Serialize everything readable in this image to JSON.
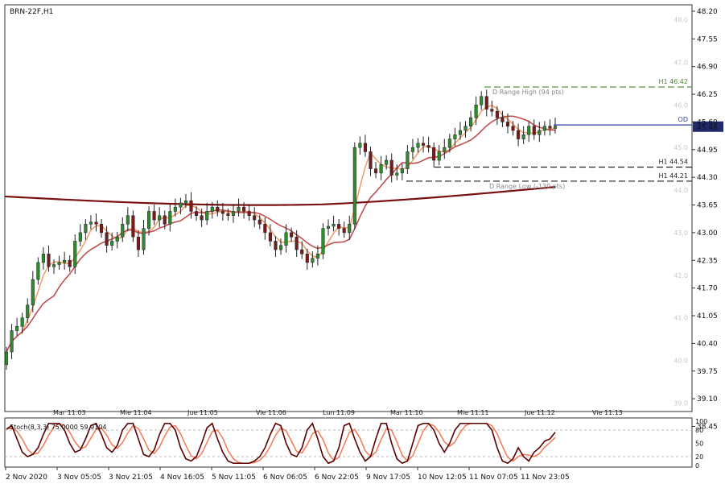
{
  "chart_data": {
    "type": "candlestick",
    "symbol_label": "BRN-22F,H1",
    "price_axis": {
      "ylim": [
        38.8,
        48.35
      ],
      "ticks": [
        "48.20",
        "47.55",
        "46.90",
        "46.25",
        "45.60",
        "44.95",
        "44.30",
        "43.65",
        "43.00",
        "42.35",
        "41.70",
        "41.05",
        "40.40",
        "39.75",
        "39.10",
        "38.45"
      ]
    },
    "background_levels": [
      "48.0",
      "47.0",
      "46.0",
      "45.0",
      "44.0",
      "43.0",
      "42.0",
      "41.0",
      "40.0",
      "39.0"
    ],
    "session_labels": [
      "Mar 11.03",
      "Mie 11.04",
      "Jue 11.05",
      "Vie 11.06",
      "Lun 11.09",
      "Mar 11.10",
      "Mie 11.11",
      "Jue 11.12",
      "Vie 11.13"
    ],
    "time_labels": [
      "2 Nov 2020",
      "3 Nov 05:05",
      "3 Nov 21:05",
      "4 Nov 16:05",
      "5 Nov 11:05",
      "6 Nov 06:05",
      "6 Nov 22:05",
      "9 Nov 17:05",
      "10 Nov 12:05",
      "11 Nov 07:05",
      "11 Nov 23:05"
    ],
    "closes": [
      40.2,
      40.7,
      40.8,
      41.0,
      41.3,
      41.9,
      42.3,
      42.5,
      42.2,
      42.25,
      42.3,
      42.35,
      42.2,
      42.8,
      43.0,
      43.2,
      43.25,
      43.2,
      43.0,
      42.7,
      42.8,
      42.9,
      43.2,
      43.4,
      42.9,
      42.6,
      43.1,
      43.5,
      43.3,
      43.4,
      43.2,
      43.5,
      43.6,
      43.7,
      43.75,
      43.5,
      43.4,
      43.3,
      43.5,
      43.6,
      43.5,
      43.45,
      43.4,
      43.5,
      43.6,
      43.5,
      43.4,
      43.3,
      43.2,
      43.0,
      42.8,
      42.6,
      42.7,
      43.0,
      42.9,
      42.6,
      42.5,
      42.3,
      42.4,
      42.5,
      43.1,
      43.15,
      43.2,
      43.1,
      43.0,
      43.2,
      45.0,
      45.1,
      44.9,
      44.5,
      44.4,
      44.6,
      44.7,
      44.35,
      44.4,
      44.5,
      44.9,
      45.0,
      45.1,
      45.05,
      45.0,
      44.7,
      44.9,
      45.0,
      45.2,
      45.3,
      45.4,
      45.5,
      45.7,
      46.0,
      46.2,
      45.9,
      45.85,
      45.7,
      45.6,
      45.5,
      45.4,
      45.2,
      45.3,
      45.5,
      45.3,
      45.4,
      45.5,
      45.45,
      45.5
    ],
    "overlays": [
      {
        "name": "line",
        "label": "H1 46.42",
        "value": 46.42,
        "color": "#4a8a2e",
        "style": "dashed"
      },
      {
        "name": "line",
        "label": "D Range High (94 pts)",
        "value": 46.42,
        "color": "#888888",
        "style": "dashed"
      },
      {
        "name": "line",
        "label": "OD",
        "value": 45.53,
        "color": "#2b3aa0",
        "style": "solid"
      },
      {
        "name": "line",
        "label": "H1 44.54",
        "value": 44.54,
        "color": "#222222",
        "style": "dashed"
      },
      {
        "name": "line",
        "label": "H1 44.21",
        "value": 44.21,
        "color": "#222222",
        "style": "dashed"
      },
      {
        "name": "line",
        "label": "D Range Low (-130 pts)",
        "value": 44.21,
        "color": "#888888",
        "style": "dashed"
      }
    ],
    "current_price": "45.48",
    "moving_averages": [
      {
        "name": "ma-fast",
        "color": "#f0a070",
        "period": 20
      },
      {
        "name": "ma-mid",
        "color": "#c05050",
        "period": 50
      },
      {
        "name": "ma-slow",
        "color": "#7a1010",
        "period": 200
      }
    ],
    "oscillator": {
      "label": "Stoch(8,3,3) 75.0000 59.9104",
      "ylim": [
        0,
        100
      ],
      "ticks": [
        "100",
        "80",
        "50",
        "20",
        "0"
      ],
      "main_color": "#5a0000",
      "signal_color": "#f08060",
      "values": [
        82,
        90,
        60,
        30,
        20,
        25,
        40,
        70,
        95,
        95,
        95,
        80,
        50,
        30,
        35,
        60,
        90,
        95,
        70,
        40,
        30,
        45,
        80,
        95,
        95,
        60,
        25,
        20,
        35,
        70,
        95,
        95,
        80,
        40,
        15,
        10,
        20,
        50,
        85,
        95,
        60,
        30,
        10,
        5,
        5,
        5,
        5,
        10,
        20,
        40,
        70,
        95,
        90,
        50,
        25,
        20,
        40,
        80,
        95,
        60,
        20,
        5,
        10,
        40,
        90,
        95,
        60,
        30,
        10,
        20,
        60,
        95,
        95,
        50,
        15,
        5,
        10,
        50,
        90,
        95,
        95,
        80,
        50,
        30,
        50,
        80,
        95,
        95,
        95,
        95,
        95,
        95,
        80,
        40,
        10,
        5,
        15,
        40,
        20,
        10,
        30,
        40,
        55,
        60,
        75
      ]
    },
    "grid": true,
    "legend": "none"
  }
}
